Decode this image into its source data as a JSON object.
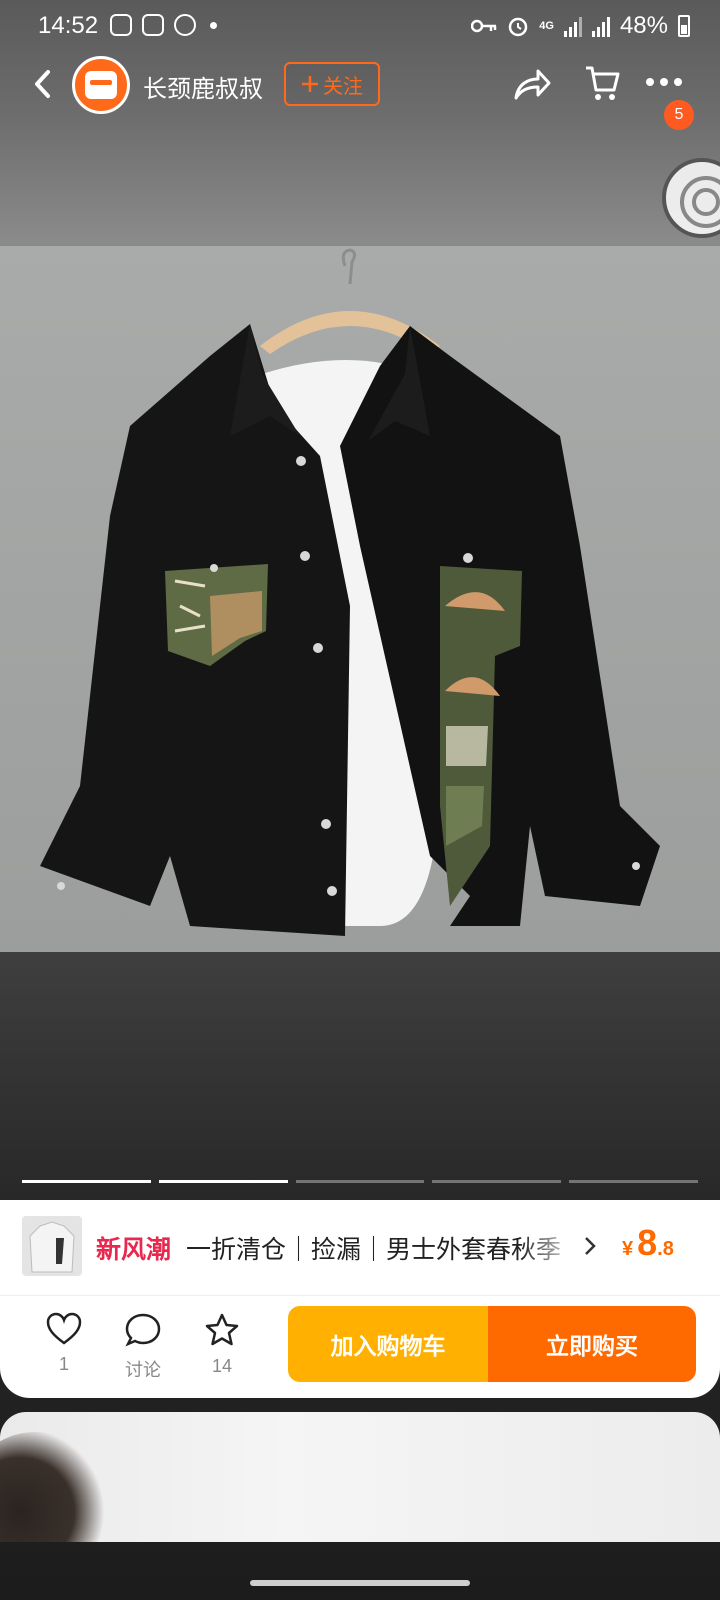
{
  "status_bar": {
    "time": "14:52",
    "battery": "48%",
    "network": "4G"
  },
  "nav": {
    "store_name": "长颈鹿叔叔",
    "follow_label": "关注",
    "cart_badge": "5"
  },
  "carousel": {
    "total": 5,
    "active": 2
  },
  "promo": {
    "tag": "新风潮",
    "text": "一折清仓｜捡漏｜男士外套春秋季",
    "price_currency": "¥",
    "price_int": "8",
    "price_dec": ".8"
  },
  "actions": {
    "like_count": "1",
    "comment_label": "讨论",
    "favorite_count": "14",
    "add_to_cart": "加入购物车",
    "buy_now": "立即购买"
  },
  "colors": {
    "accent": "#ff6a00",
    "cart_button": "#ffb000",
    "promo_tag": "#e8284e"
  }
}
